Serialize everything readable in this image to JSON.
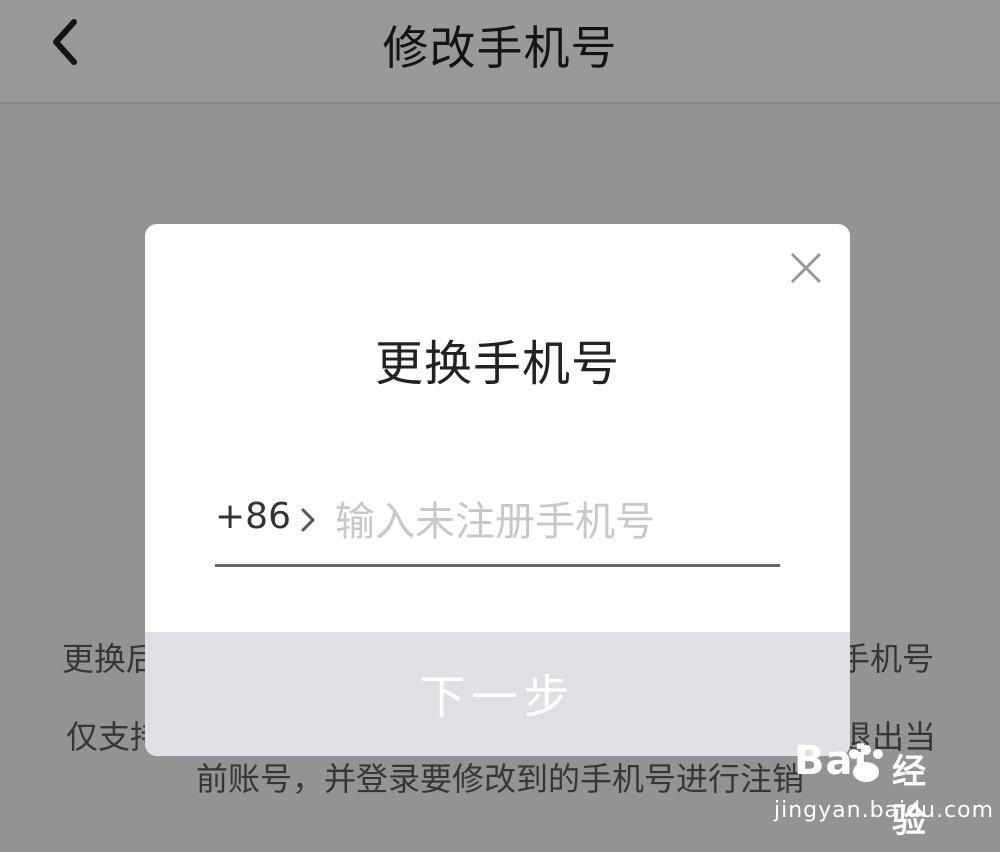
{
  "header": {
    "title": "修改手机号"
  },
  "background": {
    "line1_left": "更换后",
    "line1_right": "手机号",
    "line2_left": "仅支持",
    "line2_right": "退出当",
    "line3": "前账号，并登录要修改到的手机号进行注销"
  },
  "dialog": {
    "title": "更换手机号",
    "country_code": "+86",
    "phone_placeholder": "输入未注册手机号",
    "phone_value": "",
    "next_label": "下一步"
  },
  "watermark": {
    "brand": "Bai",
    "brand_suffix": "经验",
    "url": "jingyan.baidu.com"
  },
  "icons": {
    "back": "chevron-left-icon",
    "close": "close-icon",
    "code_chevron": "chevron-right-icon"
  }
}
